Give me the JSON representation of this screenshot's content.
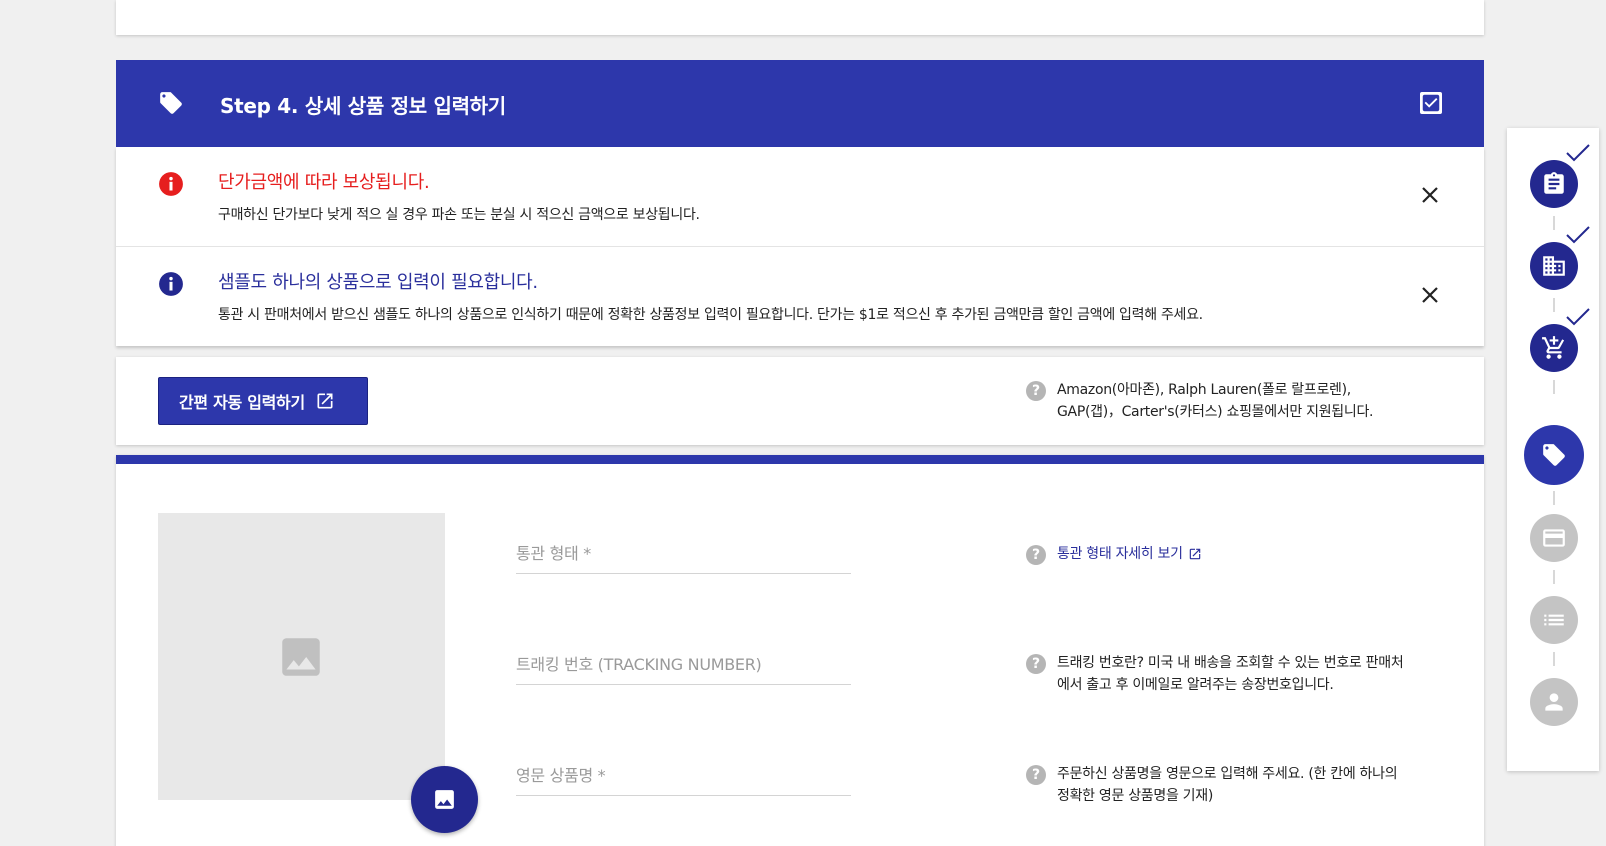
{
  "step": {
    "title": "Step 4. 상세 상품 정보 입력하기"
  },
  "notices": [
    {
      "title": "단가금액에 따라 보상됩니다.",
      "description": "구매하신 단가보다 낮게 적으 실 경우 파손 또는 분실 시 적으신 금액으로 보상됩니다.",
      "color": "#e61e1e"
    },
    {
      "title": "샘플도 하나의 상품으로 입력이 필요합니다.",
      "description": "통관 시 판매처에서 받으신 샘플도 하나의 상품으로 인식하기 때문에 정확한 상품정보 입력이 필요합니다. 단가는 $1로 적으신 후 추가된 금액만큼 할인 금액에 입력해 주세요.",
      "color": "#2a2f9c"
    }
  ],
  "auto_input": {
    "button_label": "간편 자동 입력하기",
    "help_line1": "Amazon(아마존), Ralph Lauren(폴로 랄프로렌),",
    "help_line2": "GAP(갭)，Carter's(카터스) 쇼핑몰에서만 지원됩니다."
  },
  "form": {
    "customs_type_placeholder": "통관 형태 *",
    "customs_type_help_link": "통관 형태 자세히 보기",
    "tracking_placeholder": "트래킹 번호 (TRACKING NUMBER)",
    "tracking_help_line1": "트래킹 번호란? 미국 내 배송을 조회할 수 있는 번호로 판매처",
    "tracking_help_line2": "에서 출고 후 이메일로 알려주는 송장번호입니다.",
    "product_name_placeholder": "영문 상품명 *",
    "product_name_help_line1": "주문하신 상품명을 영문으로 입력해 주세요. (한 칸에 하나의",
    "product_name_help_line2": "정확한 영문 상품명을 기재)"
  },
  "progress_steps": [
    {
      "icon": "clipboard-icon",
      "state": "done"
    },
    {
      "icon": "building-icon",
      "state": "done"
    },
    {
      "icon": "cart-add-icon",
      "state": "done"
    },
    {
      "icon": "tag-icon",
      "state": "active"
    },
    {
      "icon": "credit-card-icon",
      "state": "todo"
    },
    {
      "icon": "list-icon",
      "state": "todo"
    },
    {
      "icon": "person-icon",
      "state": "todo"
    }
  ],
  "colors": {
    "primary": "#2d37ab",
    "primary_dark": "#23288f",
    "error": "#e61e1e",
    "inactive": "#c4c4c4"
  }
}
